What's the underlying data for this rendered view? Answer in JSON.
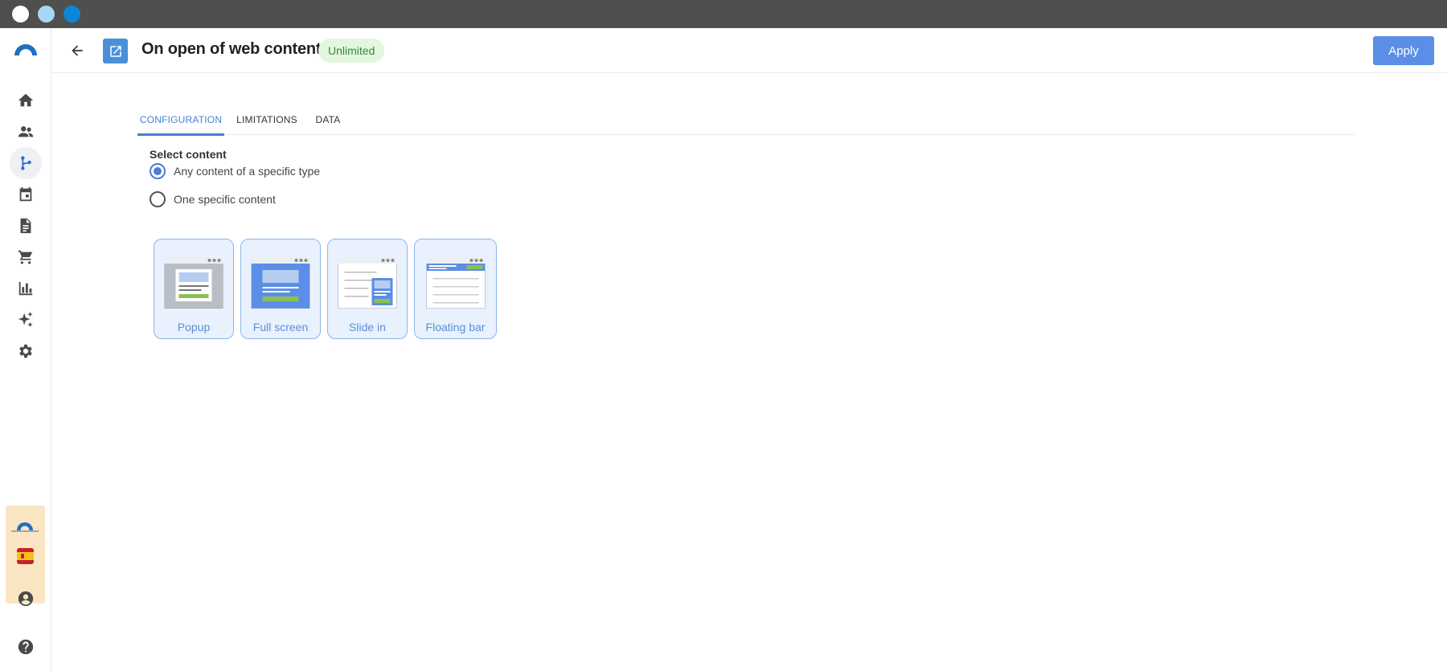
{
  "header": {
    "title": "On open of web content",
    "badge": "Unlimited",
    "apply_label": "Apply"
  },
  "sidebar": {
    "items": [
      {
        "name": "home-icon"
      },
      {
        "name": "people-icon"
      },
      {
        "name": "flow-icon",
        "active": true
      },
      {
        "name": "calendar-icon"
      },
      {
        "name": "document-icon"
      },
      {
        "name": "cart-icon"
      },
      {
        "name": "bar-chart-icon"
      },
      {
        "name": "sparkle-icon"
      },
      {
        "name": "gear-icon"
      }
    ],
    "bottom": [
      {
        "name": "account-icon"
      },
      {
        "name": "help-icon"
      }
    ]
  },
  "tabs": [
    {
      "label": "CONFIGURATION",
      "active": true
    },
    {
      "label": "LIMITATIONS"
    },
    {
      "label": "DATA"
    }
  ],
  "config": {
    "section_label": "Select content",
    "options": [
      {
        "label": "Any content of a specific type",
        "checked": true
      },
      {
        "label": "One specific content",
        "checked": false
      }
    ],
    "content_types": [
      {
        "label": "Popup"
      },
      {
        "label": "Full screen"
      },
      {
        "label": "Slide in"
      },
      {
        "label": "Floating bar"
      }
    ]
  },
  "colors": {
    "accent": "#4a7fd4",
    "apply": "#5b8ee6",
    "badge_bg": "#e3f6df",
    "badge_text": "#2e8b3a"
  }
}
